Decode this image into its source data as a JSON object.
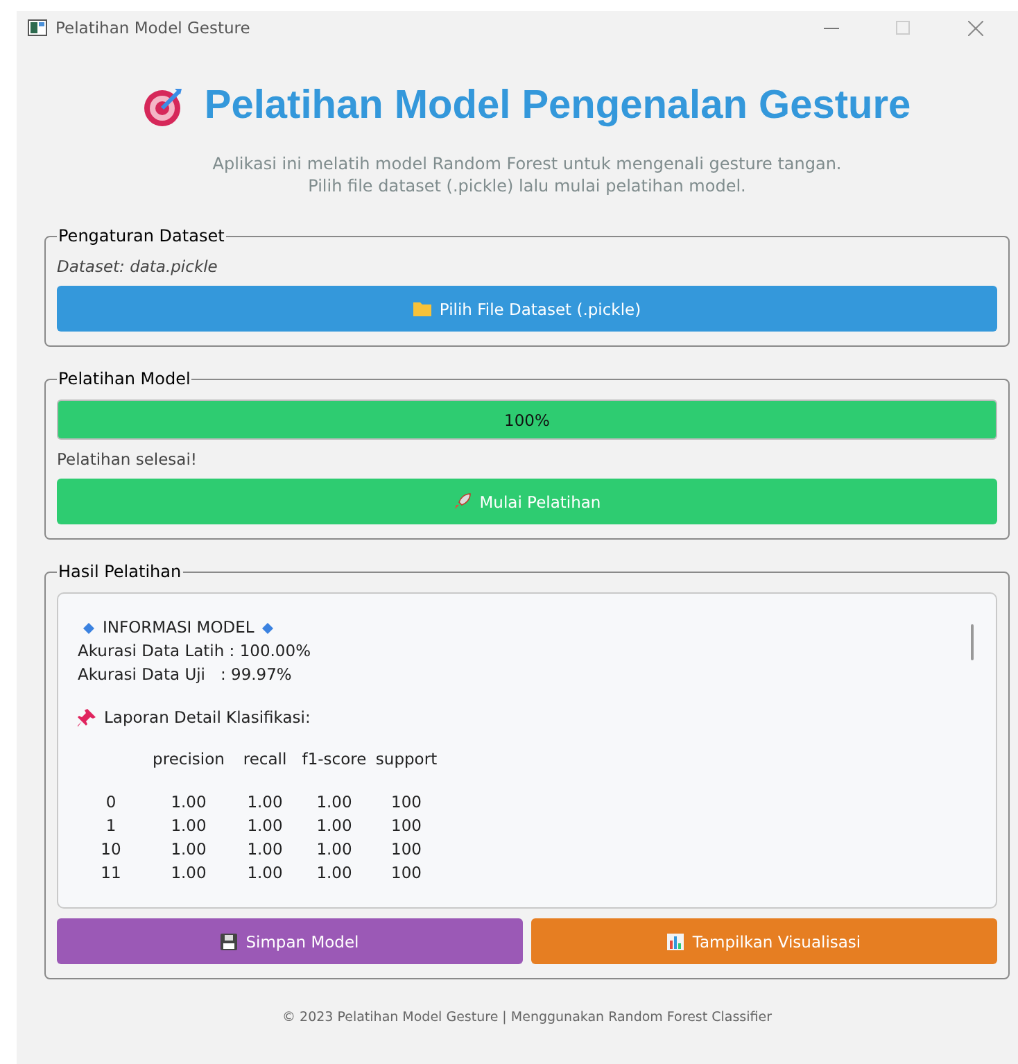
{
  "window": {
    "title": "Pelatihan Model Gesture"
  },
  "header": {
    "title": "Pelatihan Model Pengenalan Gesture",
    "subtitle_lines": [
      "Aplikasi ini melatih model Random Forest untuk mengenali gesture tangan.",
      "Pilih file dataset (.pickle) lalu mulai pelatihan model."
    ]
  },
  "dataset_group": {
    "title": "Pengaturan Dataset",
    "dataset_label": "Dataset: data.pickle",
    "button": "Pilih File Dataset (.pickle)"
  },
  "training_group": {
    "title": "Pelatihan Model",
    "progress": {
      "level": 1,
      "text": "100%"
    },
    "status": "Pelatihan selesai!",
    "button": "Mulai Pelatihan"
  },
  "results_group": {
    "title": "Hasil Pelatihan",
    "info_title": "INFORMASI MODEL",
    "info_lines": [
      "Akurasi Data Latih : 100.00%",
      "Akurasi Data Uji   : 99.97%"
    ],
    "report_title": "Laporan Detail Klasifikasi:",
    "report_columns": [
      "precision",
      "recall",
      "f1-score",
      "support"
    ],
    "report_rows": [
      {
        "label": "0",
        "cells": [
          "1.00",
          "1.00",
          "1.00",
          "100"
        ]
      },
      {
        "label": "1",
        "cells": [
          "1.00",
          "1.00",
          "1.00",
          "100"
        ]
      },
      {
        "label": "10",
        "cells": [
          "1.00",
          "1.00",
          "1.00",
          "100"
        ]
      },
      {
        "label": "11",
        "cells": [
          "1.00",
          "1.00",
          "1.00",
          "100"
        ]
      }
    ],
    "buttons": [
      {
        "kind": "save",
        "label": "Simpan Model"
      },
      {
        "kind": "chart",
        "label": "Tampilkan Visualisasi"
      }
    ]
  },
  "footer": "© 2023 Pelatihan Model Gesture | Menggunakan Random Forest Classifier"
}
